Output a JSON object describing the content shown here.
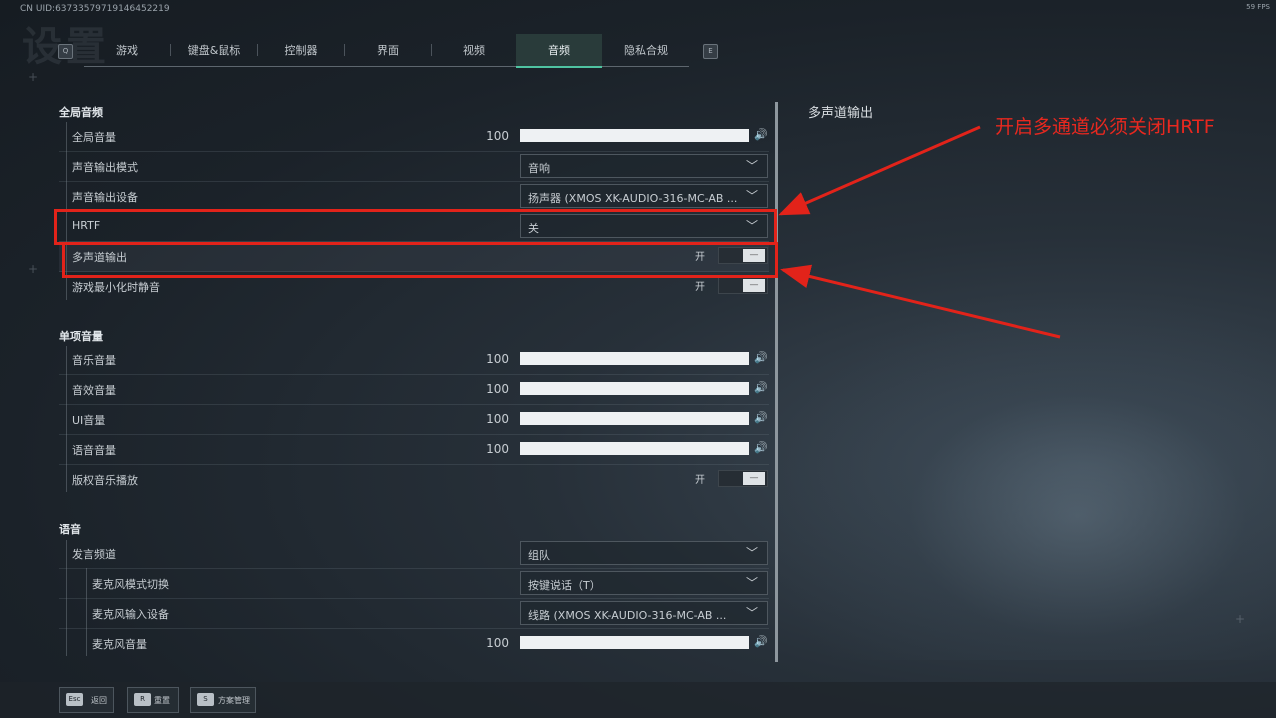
{
  "header": {
    "uid": "CN UID:6373357971914645221​9",
    "fps": "59 FPS",
    "big_title": "设置",
    "left_key": "Q",
    "right_key": "E",
    "tabs": [
      "游戏",
      "键盘&鼠标",
      "控制器",
      "界面",
      "视频",
      "音频",
      "隐私合规"
    ],
    "active_tab": "音频"
  },
  "sections": {
    "global": {
      "title": "全局音频",
      "master_volume": {
        "label": "全局音量",
        "value": "100",
        "fill": 1.0
      },
      "output_mode": {
        "label": "声音输出模式",
        "value": "音响"
      },
      "output_device": {
        "label": "声音输出设备",
        "value": "扬声器 (XMOS XK-AUDIO-316-MC-AB ..."
      },
      "hrtf": {
        "label": "HRTF",
        "value": "关"
      },
      "multichannel": {
        "label": "多声道输出",
        "state": "开"
      },
      "mute_minimized": {
        "label": "游戏最小化时静音",
        "state": "开"
      }
    },
    "individual": {
      "title": "单项音量",
      "music": {
        "label": "音乐音量",
        "value": "100",
        "fill": 1.0
      },
      "sfx": {
        "label": "音效音量",
        "value": "100",
        "fill": 1.0
      },
      "ui": {
        "label": "UI音量",
        "value": "100",
        "fill": 1.0
      },
      "voice": {
        "label": "语音音量",
        "value": "100",
        "fill": 1.0
      },
      "copyright_music": {
        "label": "版权音乐播放",
        "state": "开"
      }
    },
    "voice_chat": {
      "title": "语音",
      "channel": {
        "label": "发言频道",
        "value": "组队"
      },
      "mic_mode": {
        "label": "麦克风模式切换",
        "value": "按键说话（T）"
      },
      "mic_device": {
        "label": "麦克风输入设备",
        "value": "线路 (XMOS XK-AUDIO-316-MC-AB ..."
      },
      "mic_volume": {
        "label": "麦克风音量",
        "value": "100",
        "fill": 1.0
      }
    }
  },
  "right_panel": {
    "title": "多声道输出"
  },
  "annotation": {
    "text": "开启多通道必须关闭HRTF",
    "color": "#e2231a"
  },
  "footer": {
    "back": {
      "key": "Esc",
      "label": "返回"
    },
    "reset": {
      "key": "R",
      "label": "重置"
    },
    "scheme": {
      "key": "S",
      "label": "方案管理"
    }
  },
  "colors": {
    "accent": "#4fc3a1",
    "annotation": "#e2231a"
  }
}
